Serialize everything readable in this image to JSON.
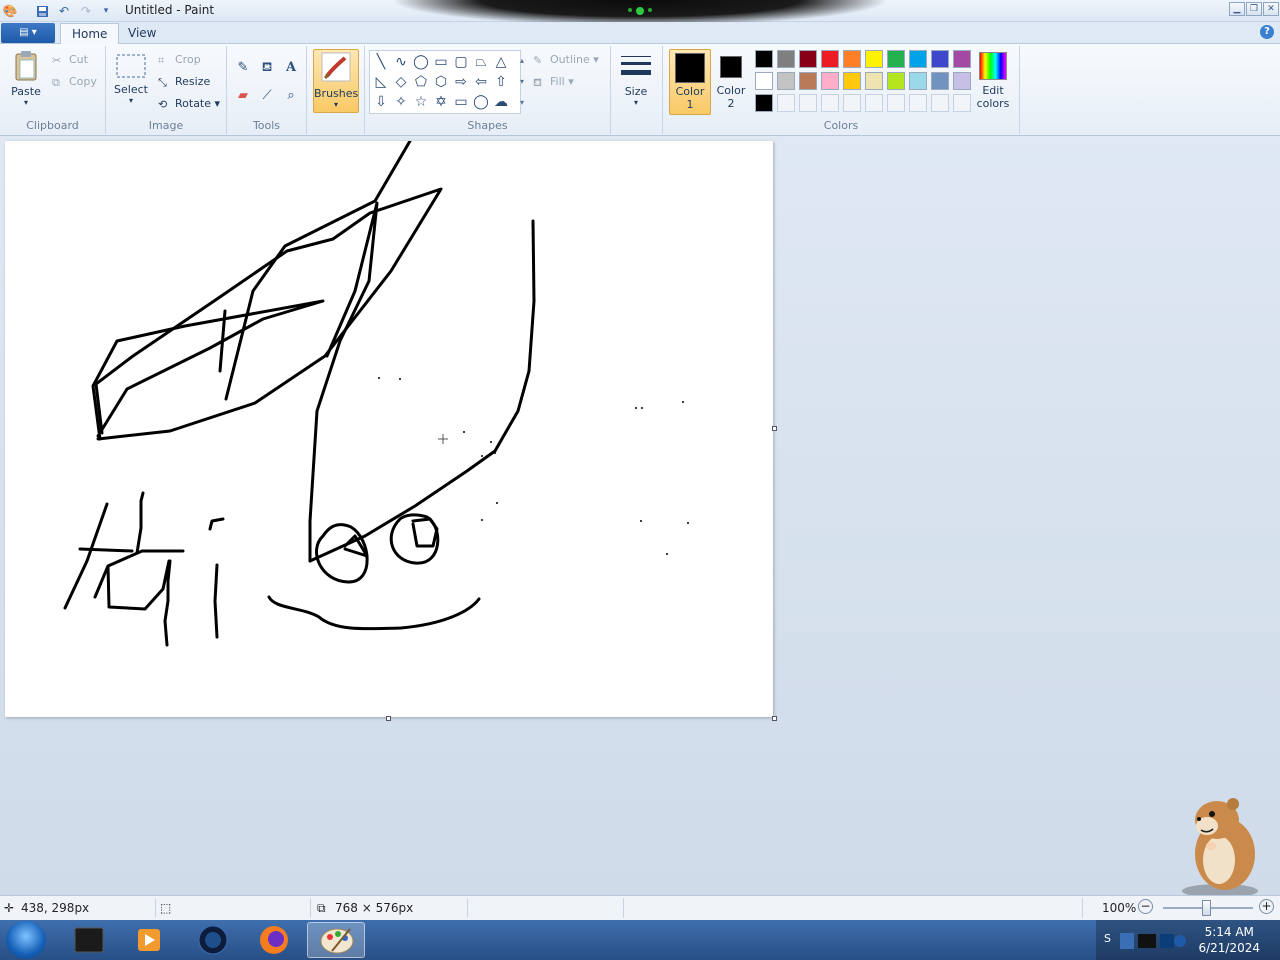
{
  "window": {
    "title": "Untitled - Paint"
  },
  "tabs": [
    {
      "label": "Home"
    },
    {
      "label": "View"
    }
  ],
  "ribbon": {
    "clipboard": {
      "paste": "Paste",
      "cut": "Cut",
      "copy": "Copy",
      "label": "Clipboard"
    },
    "image": {
      "select": "Select",
      "crop": "Crop",
      "resize": "Resize",
      "rotate": "Rotate",
      "label": "Image"
    },
    "tools": {
      "label": "Tools"
    },
    "brushes": {
      "label": "Brushes"
    },
    "shapes": {
      "outline": "Outline",
      "fill": "Fill",
      "label": "Shapes"
    },
    "size": {
      "label": "Size"
    },
    "colors": {
      "color1": "Color\n1",
      "color2": "Color\n2",
      "color1_line1": "Color",
      "color1_line2": "1",
      "color2_line1": "Color",
      "color2_line2": "2",
      "edit_line1": "Edit",
      "edit_line2": "colors",
      "label": "Colors",
      "color1_value": "#000000",
      "color2_value": "#000000",
      "palette_row1": [
        "#000000",
        "#7f7f7f",
        "#880015",
        "#ed1c24",
        "#ff7f27",
        "#fff200",
        "#22b14c",
        "#00a2e8",
        "#3f48cc",
        "#a349a4"
      ],
      "palette_row2": [
        "#ffffff",
        "#c3c3c3",
        "#b97a57",
        "#ffaec9",
        "#ffc90e",
        "#efe4b0",
        "#b5e61d",
        "#99d9ea",
        "#7092be",
        "#c8bfe7"
      ],
      "palette_row3": [
        "#000000"
      ]
    }
  },
  "status": {
    "cursor_pos": "438, 298px",
    "image_size": "768 × 576px",
    "zoom": "100%"
  },
  "taskbar": {
    "clock_time": "5:14 AM",
    "clock_date": "6/21/2024",
    "apps": [
      "terminal-app",
      "media-player-app",
      "globe-app",
      "firefox-app",
      "paint-app"
    ]
  },
  "canvas_text": {}
}
